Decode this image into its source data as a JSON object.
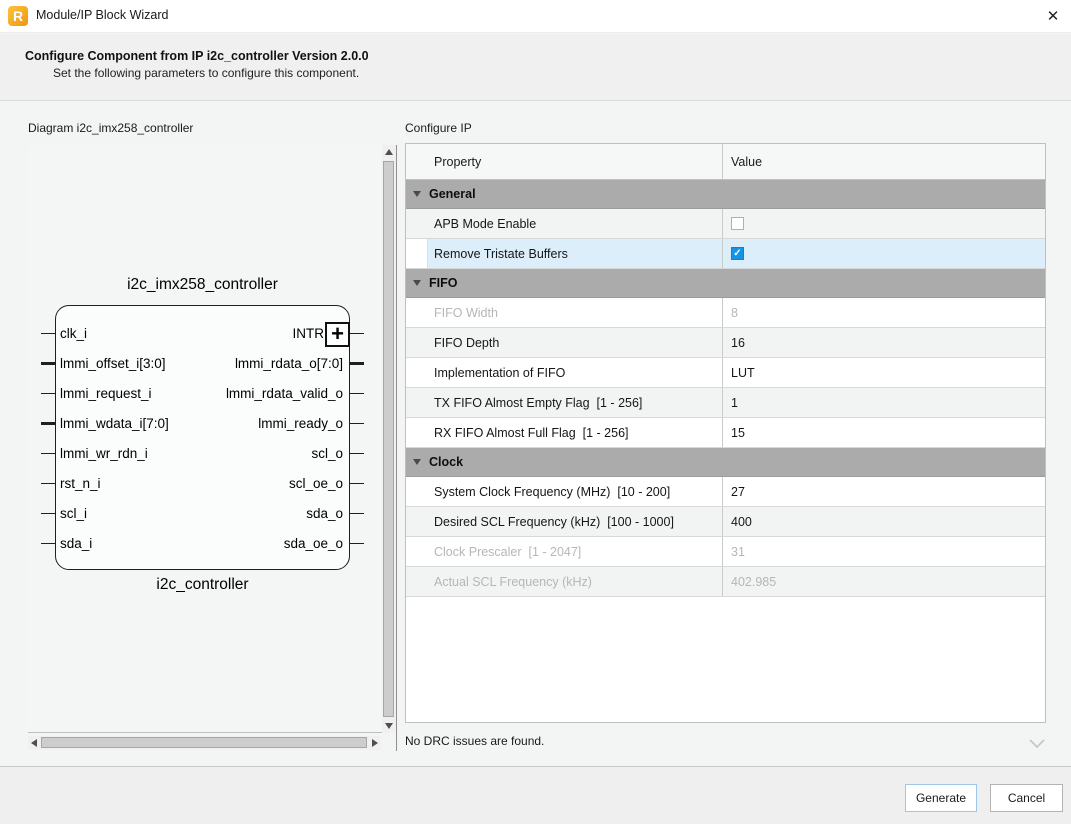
{
  "window": {
    "title": "Module/IP Block Wizard",
    "close_glyph": "✕",
    "logo_letter": "R"
  },
  "header": {
    "title": "Configure Component from IP i2c_controller Version 2.0.0",
    "subtitle": "Set the following parameters to configure this component."
  },
  "diagram": {
    "label": "Diagram i2c_imx258_controller",
    "block_title": "i2c_imx258_controller",
    "block_footer": "i2c_controller",
    "left_ports": [
      {
        "name": "clk_i",
        "bus": false
      },
      {
        "name": "lmmi_offset_i[3:0]",
        "bus": true
      },
      {
        "name": "lmmi_request_i",
        "bus": false
      },
      {
        "name": "lmmi_wdata_i[7:0]",
        "bus": true
      },
      {
        "name": "lmmi_wr_rdn_i",
        "bus": false
      },
      {
        "name": "rst_n_i",
        "bus": false
      },
      {
        "name": "scl_i",
        "bus": false
      },
      {
        "name": "sda_i",
        "bus": false
      }
    ],
    "right_ports": [
      {
        "name": "INTR",
        "bus": false,
        "zoom_overlay": true
      },
      {
        "name": "lmmi_rdata_o[7:0]",
        "bus": true
      },
      {
        "name": "lmmi_rdata_valid_o",
        "bus": false
      },
      {
        "name": "lmmi_ready_o",
        "bus": false
      },
      {
        "name": "scl_o",
        "bus": false
      },
      {
        "name": "scl_oe_o",
        "bus": false
      },
      {
        "name": "sda_o",
        "bus": false
      },
      {
        "name": "sda_oe_o",
        "bus": false
      }
    ],
    "zoom_plus_glyph": "+"
  },
  "configure_ip": {
    "panel_label": "Configure IP",
    "columns": [
      "Property",
      "Value"
    ],
    "groups": [
      {
        "name": "General",
        "rows": [
          {
            "property": "APB Mode Enable",
            "type": "checkbox",
            "checked": false
          },
          {
            "property": "Remove Tristate Buffers",
            "type": "checkbox",
            "checked": true,
            "selected": true
          }
        ]
      },
      {
        "name": "FIFO",
        "rows": [
          {
            "property": "FIFO Width",
            "value": "8",
            "disabled": true
          },
          {
            "property": "FIFO Depth",
            "value": "16"
          },
          {
            "property": "Implementation of FIFO",
            "value": "LUT"
          },
          {
            "property": "TX FIFO Almost Empty Flag  [1 - 256]",
            "value": "1"
          },
          {
            "property": "RX FIFO Almost Full Flag  [1 - 256]",
            "value": "15"
          }
        ]
      },
      {
        "name": "Clock",
        "rows": [
          {
            "property": "System Clock Frequency (MHz)  [10 - 200]",
            "value": "27"
          },
          {
            "property": "Desired SCL Frequency (kHz)  [100 - 1000]",
            "value": "400"
          },
          {
            "property": "Clock Prescaler  [1 - 2047]",
            "value": "31",
            "disabled": true
          },
          {
            "property": "Actual SCL Frequency (kHz)",
            "value": "402.985",
            "disabled": true
          }
        ]
      }
    ],
    "checkbox_check_glyph": "✓"
  },
  "status": {
    "message": "No DRC issues are found."
  },
  "footer": {
    "generate_label": "Generate",
    "cancel_label": "Cancel"
  },
  "colors": {
    "accent_blue": "#1593e6",
    "selected_row": "#ddeefb",
    "group_header": "#ababab",
    "logo_orange": "#f5a821",
    "disabled_text": "#b5b7b7"
  }
}
